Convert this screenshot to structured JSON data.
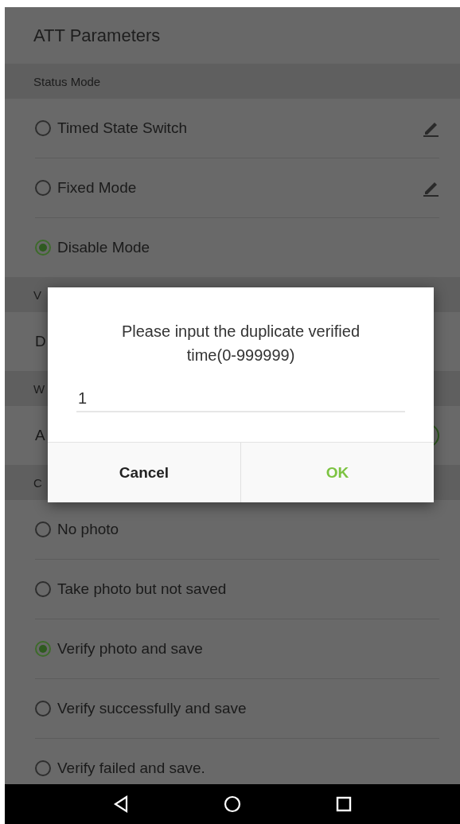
{
  "header": {
    "title": "ATT Parameters"
  },
  "sections": [
    {
      "title": "Status Mode",
      "items": [
        {
          "kind": "radio",
          "label": "Timed State Switch",
          "selected": false,
          "editable": true
        },
        {
          "kind": "radio",
          "label": "Fixed Mode",
          "selected": false,
          "editable": true
        },
        {
          "kind": "radio",
          "label": "Disable Mode",
          "selected": true,
          "editable": false
        }
      ]
    },
    {
      "title": "V",
      "items": [
        {
          "kind": "text",
          "label": "D"
        }
      ]
    },
    {
      "title": "W",
      "items": [
        {
          "kind": "toggle",
          "label": "A",
          "on": true
        }
      ]
    },
    {
      "title": "C",
      "items": [
        {
          "kind": "radio",
          "label": "No photo",
          "selected": false,
          "editable": false
        },
        {
          "kind": "radio",
          "label": "Take photo but not saved",
          "selected": false,
          "editable": false
        },
        {
          "kind": "radio",
          "label": "Verify photo and save",
          "selected": true,
          "editable": false
        },
        {
          "kind": "radio",
          "label": "Verify successfully and save",
          "selected": false,
          "editable": false
        },
        {
          "kind": "radio",
          "label": "Verify failed and save.",
          "selected": false,
          "editable": false
        }
      ]
    }
  ],
  "dialog": {
    "message": "Please input the duplicate verified time(0-999999)",
    "value": "1",
    "buttons": [
      {
        "kind": "cancel",
        "label": "Cancel"
      },
      {
        "kind": "confirm",
        "label": "OK"
      }
    ]
  }
}
